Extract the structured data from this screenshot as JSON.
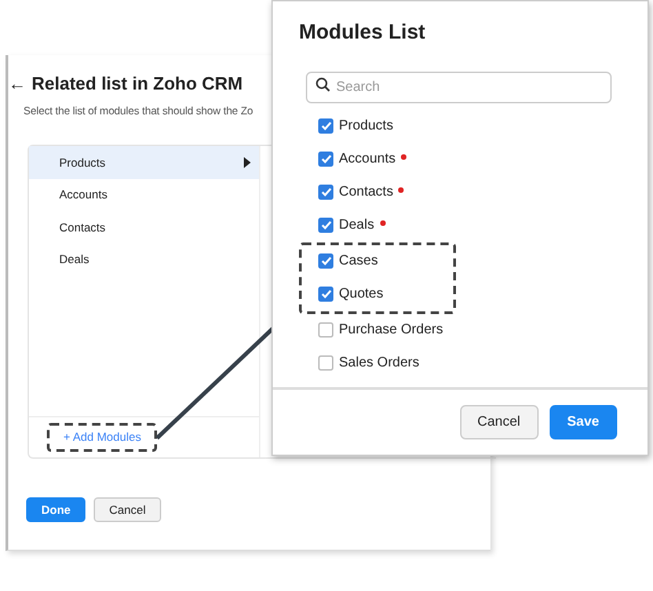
{
  "related_panel": {
    "title": "Related list in Zoho CRM",
    "back_icon": "←",
    "subtitle": "Select the list of modules that should show the Zo",
    "modules": [
      {
        "label": "Products",
        "selected": true
      },
      {
        "label": "Accounts",
        "selected": false
      },
      {
        "label": "Contacts",
        "selected": false
      },
      {
        "label": "Deals",
        "selected": false
      }
    ],
    "add_link": "+ Add Modules",
    "buttons": [
      {
        "label": "Done",
        "kind": "primary"
      },
      {
        "label": "Cancel",
        "kind": "secondary"
      }
    ]
  },
  "modules_popup": {
    "title": "Modules List",
    "search": {
      "placeholder": "Search"
    },
    "items": [
      {
        "label": "Products",
        "checked": true,
        "required": false
      },
      {
        "label": "Accounts",
        "checked": true,
        "required": true
      },
      {
        "label": "Contacts",
        "checked": true,
        "required": true
      },
      {
        "label": "Deals",
        "checked": true,
        "required": true
      },
      {
        "label": "Cases",
        "checked": true,
        "required": false,
        "highlighted": true
      },
      {
        "label": "Quotes",
        "checked": true,
        "required": false,
        "highlighted": true
      },
      {
        "label": "Purchase Orders",
        "checked": false,
        "required": false
      },
      {
        "label": "Sales Orders",
        "checked": false,
        "required": false
      }
    ],
    "buttons": [
      {
        "label": "Cancel",
        "kind": "secondary"
      },
      {
        "label": "Save",
        "kind": "primary"
      }
    ]
  }
}
